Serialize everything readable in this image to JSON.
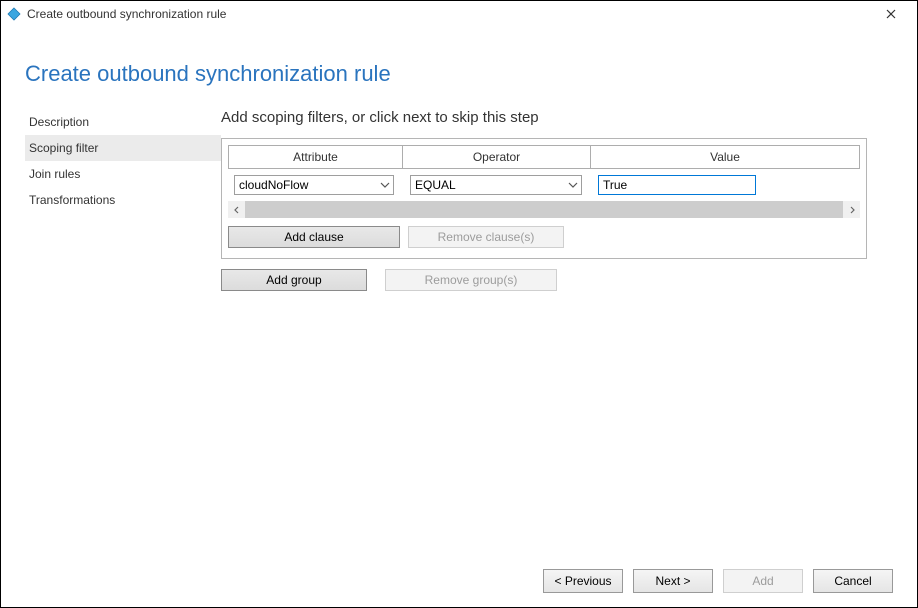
{
  "window": {
    "title": "Create outbound synchronization rule"
  },
  "page": {
    "title": "Create outbound synchronization rule"
  },
  "sidebar": {
    "items": [
      {
        "label": "Description"
      },
      {
        "label": "Scoping filter"
      },
      {
        "label": "Join rules"
      },
      {
        "label": "Transformations"
      }
    ],
    "selected_index": 1
  },
  "main": {
    "heading": "Add scoping filters, or click next to skip this step",
    "columns": {
      "attribute": "Attribute",
      "operator": "Operator",
      "value": "Value"
    },
    "row": {
      "attribute": "cloudNoFlow",
      "operator": "EQUAL",
      "value": "True"
    },
    "buttons": {
      "add_clause": "Add clause",
      "remove_clause": "Remove clause(s)",
      "add_group": "Add group",
      "remove_group": "Remove group(s)"
    }
  },
  "footer": {
    "previous": "< Previous",
    "next": "Next >",
    "add": "Add",
    "cancel": "Cancel"
  }
}
